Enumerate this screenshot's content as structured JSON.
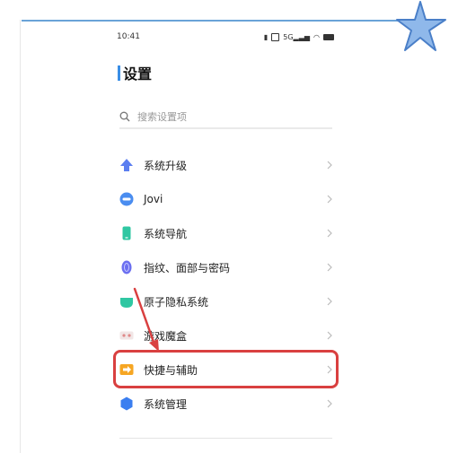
{
  "status_bar": {
    "time": "10:41",
    "icons": [
      "vibrate-icon",
      "nfc-icon",
      "signal-icon",
      "wifi-icon",
      "battery-icon"
    ],
    "network_label": "5G"
  },
  "page": {
    "title": "设置"
  },
  "search": {
    "placeholder": "搜索设置项"
  },
  "menu": {
    "items": [
      {
        "label": "系统升级",
        "icon": "upgrade-arrow-icon",
        "color": "#5b7ef0"
      },
      {
        "label": "Jovi",
        "icon": "jovi-icon",
        "color": "#4a8df0"
      },
      {
        "label": "系统导航",
        "icon": "navigation-phone-icon",
        "color": "#2fc7a2"
      },
      {
        "label": "指纹、面部与密码",
        "icon": "fingerprint-icon",
        "color": "#6b6ff0"
      },
      {
        "label": "原子隐私系统",
        "icon": "privacy-shield-icon",
        "color": "#2fc7a2"
      },
      {
        "label": "游戏魔盒",
        "icon": "game-box-icon",
        "color": "#e9a0a0"
      },
      {
        "label": "快捷与辅助",
        "icon": "shortcut-arrow-icon",
        "color": "#f6a623"
      },
      {
        "label": "系统管理",
        "icon": "system-hexagon-icon",
        "color": "#3a7ef0"
      }
    ]
  },
  "colors": {
    "accent": "#3a8ee6",
    "annotation": "#d94040"
  },
  "annotation": {
    "highlighted_item": "快捷与辅助"
  }
}
